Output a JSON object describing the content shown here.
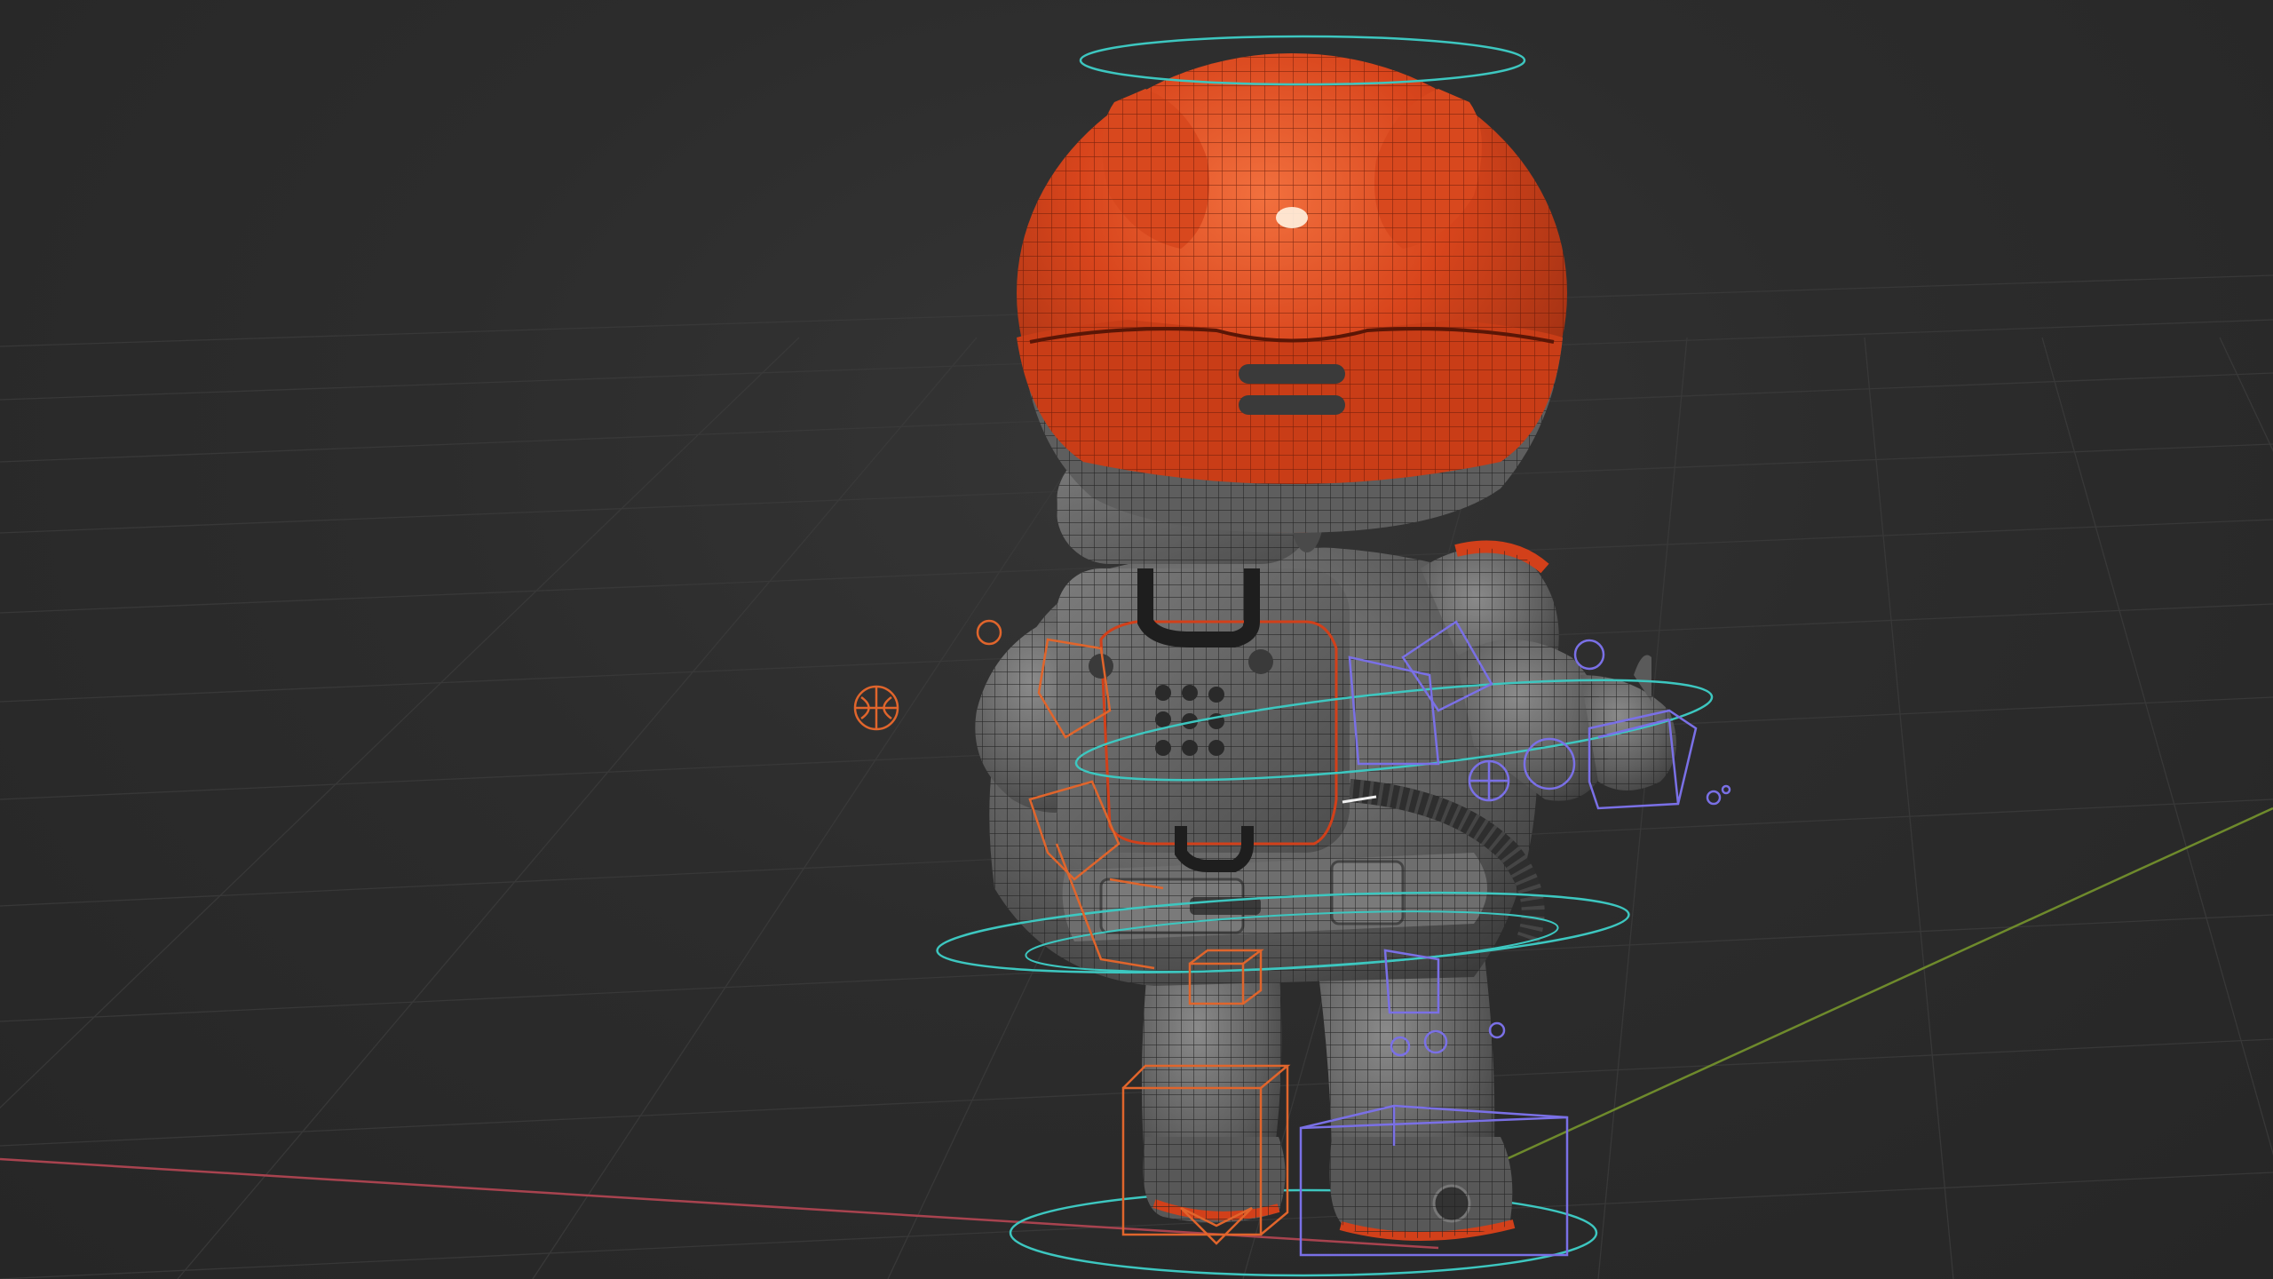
{
  "viewport": {
    "label": "",
    "model": "astronaut-character-rig",
    "colors": {
      "background": "#2b2b2b",
      "grid": "#3a3a3a",
      "x_axis": "#a8434f",
      "y_axis": "#6e8a2c",
      "helmet": "#d2401a",
      "suit": "#6a6a6a",
      "wire": "#1a1a1a",
      "ik_control": "#e0652c",
      "fk_control": "#7a70e6",
      "root_control": "#3dc7c0"
    }
  }
}
